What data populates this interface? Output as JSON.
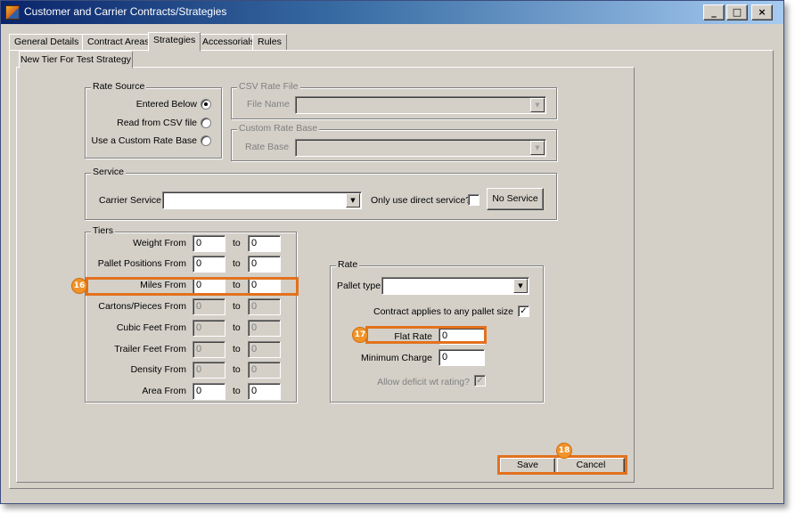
{
  "window": {
    "title": "Customer and Carrier Contracts/Strategies",
    "minimize_glyph": "_",
    "maximize_glyph": "□",
    "close_glyph": "×"
  },
  "tabs": [
    {
      "label": "General Details"
    },
    {
      "label": "Contract Areas"
    },
    {
      "label": "Strategies",
      "active": true
    },
    {
      "label": "Accessorials"
    },
    {
      "label": "Rules"
    }
  ],
  "subtab": {
    "label": "New Tier For Test Strategy"
  },
  "rate_source": {
    "legend": "Rate Source",
    "options": [
      {
        "label": "Entered Below",
        "selected": true
      },
      {
        "label": "Read from CSV file",
        "selected": false
      },
      {
        "label": "Use a Custom Rate Base",
        "selected": false
      }
    ]
  },
  "csv_rate_file": {
    "legend": "CSV Rate File",
    "file_name_label": "File Name",
    "file_name_value": ""
  },
  "custom_rate_base": {
    "legend": "Custom Rate Base",
    "rate_base_label": "Rate Base",
    "rate_base_value": ""
  },
  "service": {
    "legend": "Service",
    "carrier_service_label": "Carrier Service",
    "carrier_service_value": "",
    "direct_label": "Only use direct service?",
    "direct_checked": false,
    "no_service_button": "No Service"
  },
  "tiers": {
    "legend": "Tiers",
    "to_label": "to",
    "rows": [
      {
        "label": "Weight From",
        "from": "0",
        "to": "0",
        "enabled": true
      },
      {
        "label": "Pallet Positions From",
        "from": "0",
        "to": "0",
        "enabled": true
      },
      {
        "label": "Miles From",
        "from": "0",
        "to": "0",
        "enabled": true
      },
      {
        "label": "Cartons/Pieces From",
        "from": "0",
        "to": "0",
        "enabled": false
      },
      {
        "label": "Cubic Feet From",
        "from": "0",
        "to": "0",
        "enabled": false
      },
      {
        "label": "Trailer Feet From",
        "from": "0",
        "to": "0",
        "enabled": false
      },
      {
        "label": "Density From",
        "from": "0",
        "to": "0",
        "enabled": false
      },
      {
        "label": "Area From",
        "from": "0",
        "to": "0",
        "enabled": true
      }
    ]
  },
  "rate": {
    "legend": "Rate",
    "pallet_type_label": "Pallet type",
    "pallet_type_value": "",
    "any_pallet_label": "Contract applies to any pallet size",
    "any_pallet_checked": true,
    "flat_rate_label": "Flat Rate",
    "flat_rate_value": "0",
    "min_charge_label": "Minimum Charge",
    "min_charge_value": "0",
    "deficit_label": "Allow deficit wt rating?",
    "deficit_checked": true
  },
  "buttons": {
    "save": "Save",
    "cancel": "Cancel"
  },
  "callouts": {
    "miles": "16",
    "flat_rate": "17",
    "save_cancel": "18"
  },
  "colors": {
    "highlight": "#e2711d",
    "marker": "#f0932a",
    "face": "#d4d0c8",
    "title_bar": "#0a246a"
  },
  "icons": {
    "window_icon": "app-window-icon",
    "dropdown": "▼",
    "check": "✓"
  }
}
